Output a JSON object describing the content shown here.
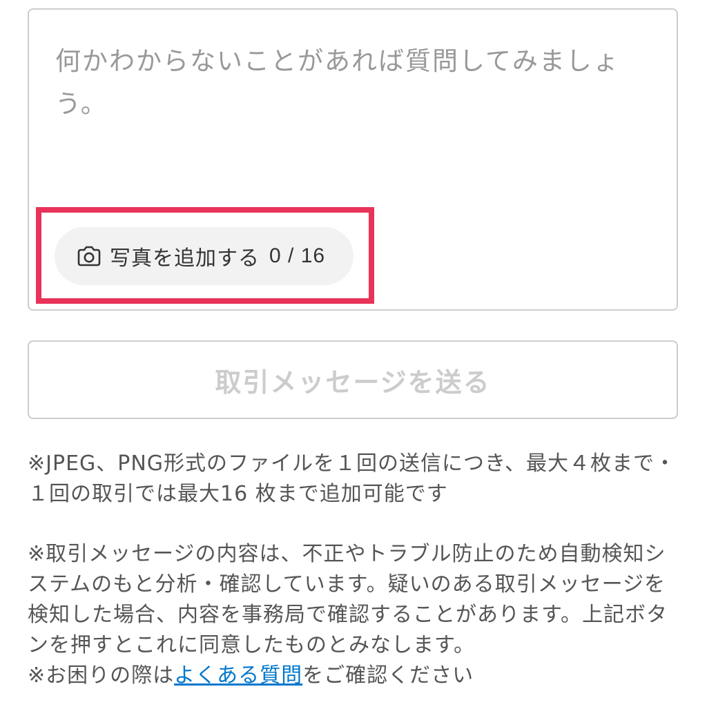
{
  "message_form": {
    "placeholder": "何かわからないことがあれば質問してみましょう。",
    "value": "",
    "add_photo": {
      "icon": "camera-icon",
      "label": "写真を追加する",
      "count": "0 / 16"
    },
    "send_label": "取引メッセージを送る"
  },
  "notes": {
    "attachment_rules": "※JPEG、PNG形式のファイルを１回の送信につき、最大４枚まで・１回の取引では最大16 枚まで追加可能です",
    "monitoring": "※取引メッセージの内容は、不正やトラブル防止のため自動検知システムのもと分析・確認しています。疑いのある取引メッセージを検知した場合、内容を事務局で確認することがあります。上記ボタンを押すとこれに同意したものとみなします。",
    "help_prefix": "※お困りの際は",
    "help_link": "よくある質問",
    "help_suffix": "をご確認ください"
  },
  "colors": {
    "highlight": "#e8335a",
    "link": "#0077cc",
    "border": "#cccccc",
    "disabled_text": "#cccccc",
    "chip_background": "#f2f2f2"
  }
}
